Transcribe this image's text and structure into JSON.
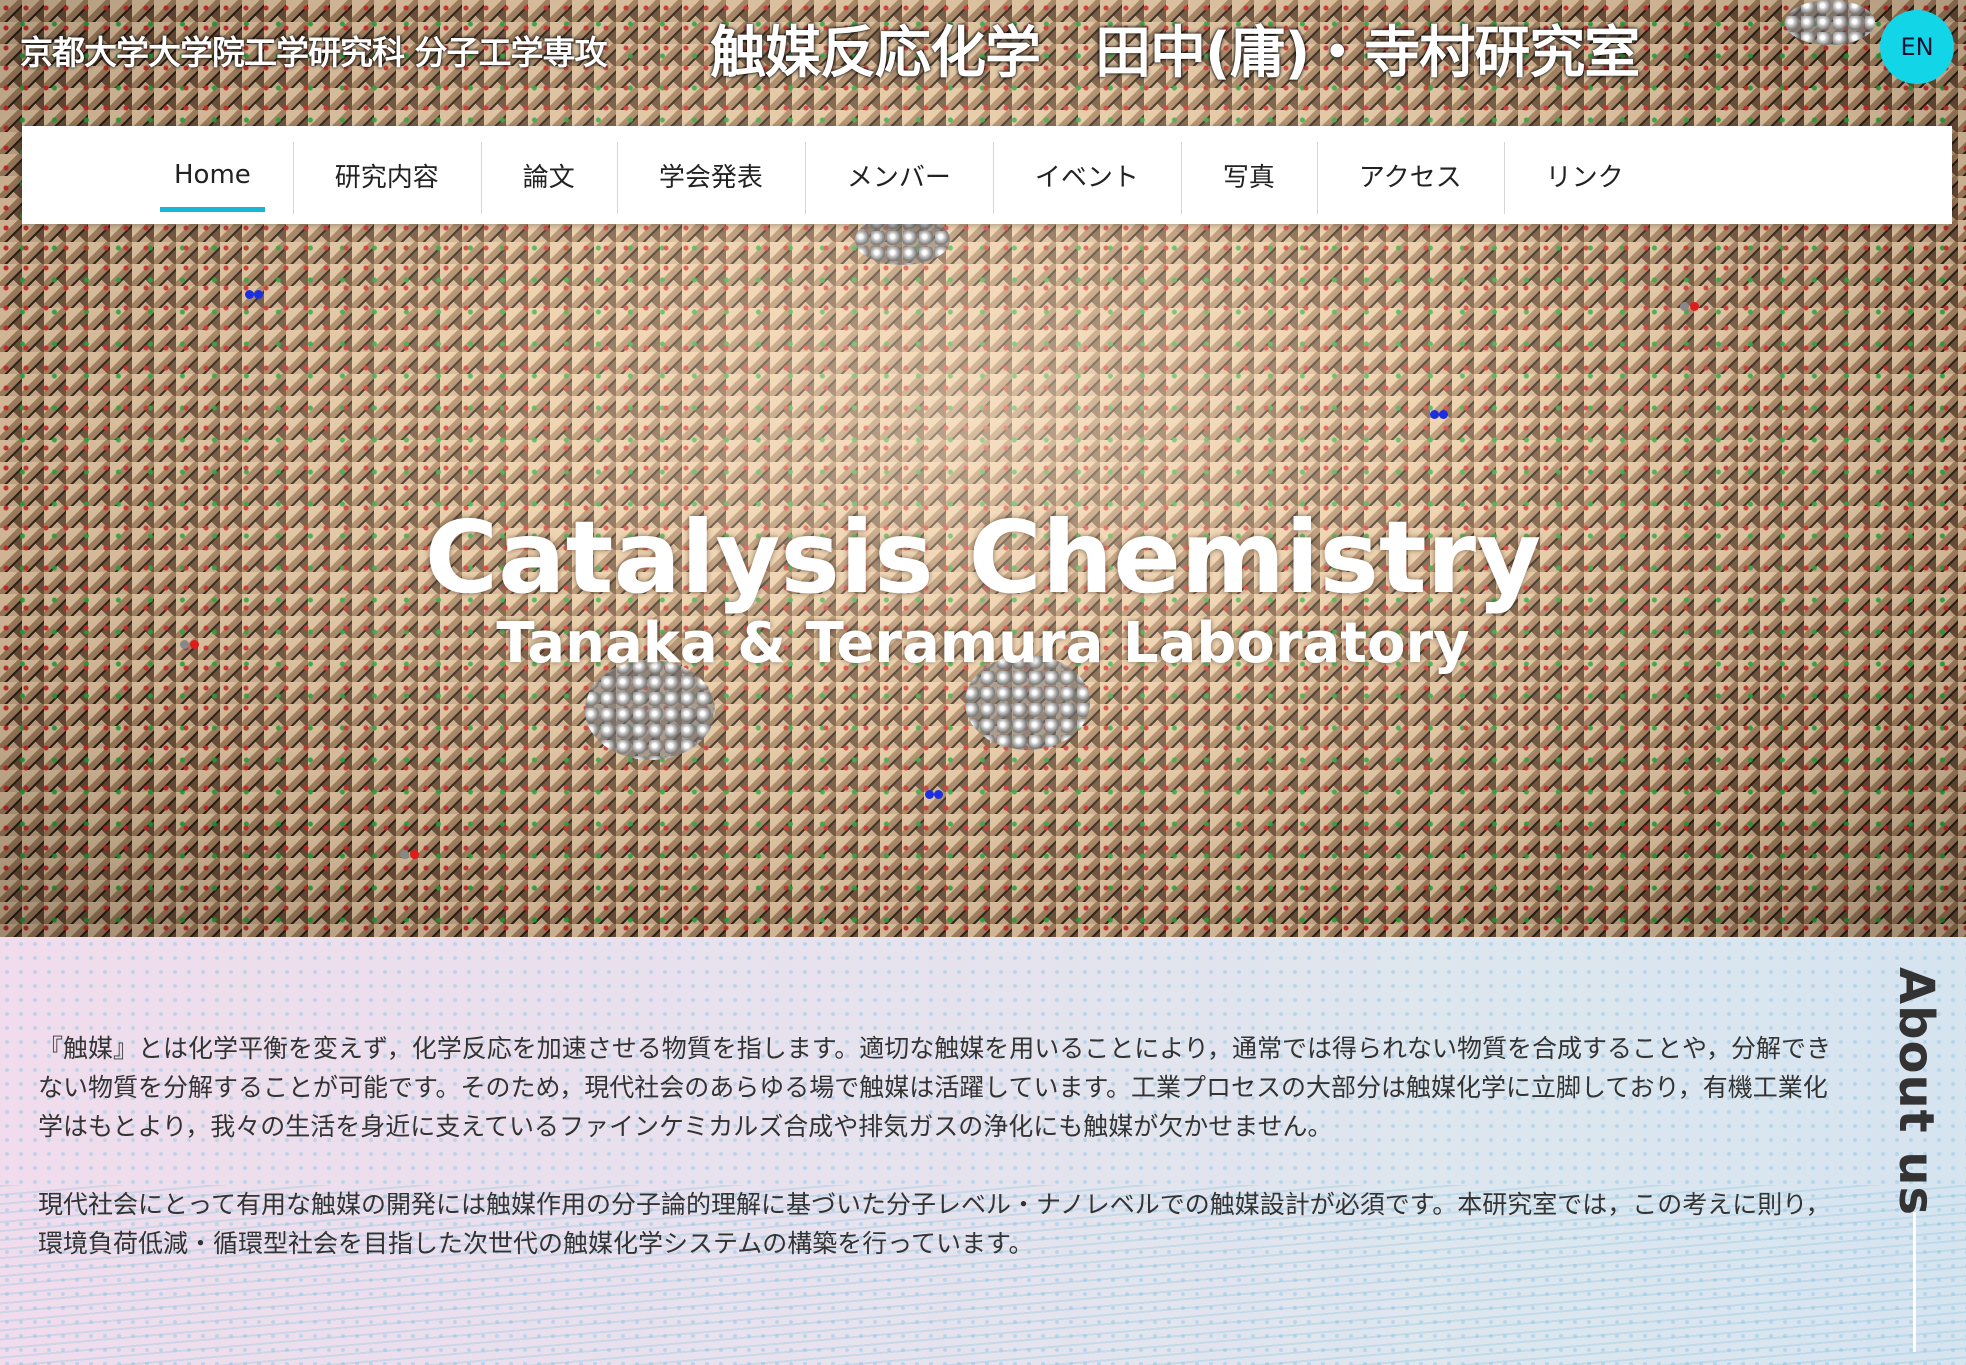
{
  "header": {
    "department": "京都大学大学院工学研究科 分子工学専攻",
    "lab_title": "触媒反応化学　田中(庸)・寺村研究室",
    "lang_button": "EN"
  },
  "nav": {
    "items": [
      {
        "label": "Home",
        "active": true
      },
      {
        "label": "研究内容"
      },
      {
        "label": "論文"
      },
      {
        "label": "学会発表"
      },
      {
        "label": "メンバー"
      },
      {
        "label": "イベント"
      },
      {
        "label": "写真"
      },
      {
        "label": "アクセス"
      },
      {
        "label": "リンク"
      }
    ],
    "active_color": "#18b6d4"
  },
  "hero": {
    "title": "Catalysis Chemistry",
    "subtitle": "Tanaka & Teramura Laboratory"
  },
  "about": {
    "label": "About us",
    "paragraphs": [
      "『触媒』とは化学平衡を変えず，化学反応を加速させる物質を指します。適切な触媒を用いることにより，通常では得られない物質を合成することや，分解できない物質を分解することが可能です。そのため，現代社会のあらゆる場で触媒は活躍しています。工業プロセスの大部分は触媒化学に立脚しており，有機工業化学はもとより，我々の生活を身近に支えているファインケミカルズ合成や排気ガスの浄化にも触媒が欠かせません。",
      "現代社会にとって有用な触媒の開発には触媒作用の分子論的理解に基づいた分子レベル・ナノレベルでの触媒設計が必須です。本研究室では，この考えに則り，環境負荷低減・循環型社会を目指した次世代の触媒化学システムの構築を行っています。"
    ]
  },
  "colors": {
    "lang_button_bg": "#12d6e8"
  }
}
